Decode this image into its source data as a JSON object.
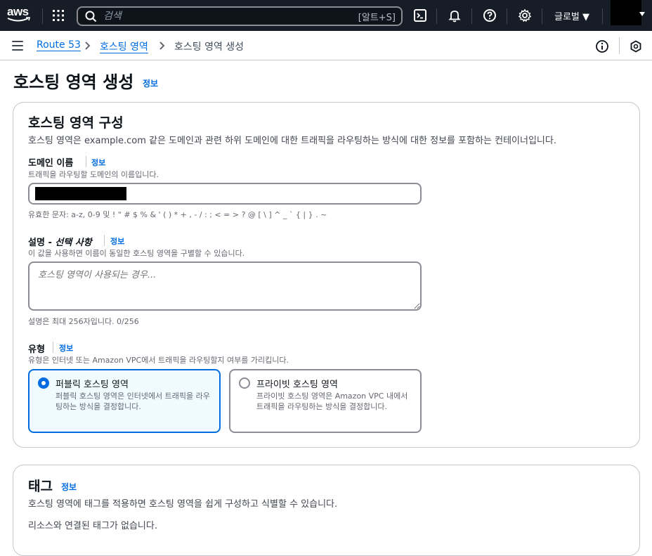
{
  "topnav": {
    "logo_text": "aws",
    "search_placeholder": "검색",
    "search_shortcut": "[알트+S]",
    "icons": [
      "services-grid-icon",
      "cloudshell-icon",
      "bell-icon",
      "help-icon",
      "gear-icon"
    ],
    "region": "글로벌 ▼"
  },
  "breadcrumb": {
    "items": [
      {
        "label": "Route 53",
        "link": true
      },
      {
        "label": "호스팅 영역",
        "link": true
      },
      {
        "label": "호스팅 영역 생성",
        "link": false
      }
    ]
  },
  "page": {
    "title": "호스팅 영역 생성",
    "info": "정보"
  },
  "config": {
    "title": "호스팅 영역 구성",
    "description": "호스팅 영역은 example.com 같은 도메인과 관련 하위 도메인에 대한 트래픽을 라우팅하는 방식에 대한 정보를 포함하는 컨테이너입니다.",
    "domain": {
      "label": "도메인 이름",
      "info": "정보",
      "description": "트래픽을 라우팅할 도메인의 이름입니다.",
      "constraint": "유효한 문자: a-z, 0-9 및 ! \" # $ % & ' ( ) * + , - / : ; < = > ? @ [ \\ ] ^ _ ` { | } . ~"
    },
    "comment": {
      "label_prefix": "설명 - ",
      "label_optional": "선택 사항",
      "info": "정보",
      "description": "이 값을 사용하면 이름이 동일한 호스팅 영역을 구별할 수 있습니다.",
      "placeholder": "호스팅 영역이 사용되는 경우...",
      "constraint": "설명은 최대 256자입니다. 0/256"
    },
    "type": {
      "label": "유형",
      "info": "정보",
      "description": "유형은 인터넷 또는 Amazon VPC에서 트래픽을 라우팅할지 여부를 가리킵니다.",
      "options": [
        {
          "title": "퍼블릭 호스팅 영역",
          "description": "퍼블릭 호스팅 영역은 인터넷에서 트래픽을 라우팅하는 방식을 결정합니다.",
          "selected": true
        },
        {
          "title": "프라이빗 호스팅 영역",
          "description": "프라이빗 호스팅 영역은 Amazon VPC 내에서 트래픽을 라우팅하는 방식을 결정합니다.",
          "selected": false
        }
      ]
    }
  },
  "tags": {
    "title": "태그",
    "info": "정보",
    "description": "호스팅 영역에 태그를 적용하면 호스팅 영역을 쉽게 구성하고 식별할 수 있습니다.",
    "empty": "리소스와 연결된 태그가 없습니다."
  },
  "colors": {
    "nav_bg": "#161d26",
    "link": "#006ce0",
    "selected_bg": "#f0fbff"
  }
}
